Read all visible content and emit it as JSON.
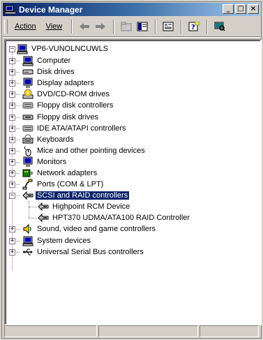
{
  "window": {
    "title": "Device Manager"
  },
  "title_buttons": {
    "minimize": "_",
    "maximize": "□",
    "close": "×"
  },
  "menu": {
    "action": "Action",
    "view": "View"
  },
  "tree": {
    "root": "VP6-VUNOLNCUWLS",
    "categories": [
      {
        "label": "Computer",
        "icon": "computer-icon"
      },
      {
        "label": "Disk drives",
        "icon": "disk-drive-icon"
      },
      {
        "label": "Display adapters",
        "icon": "monitor-icon"
      },
      {
        "label": "DVD/CD-ROM drives",
        "icon": "cdrom-icon"
      },
      {
        "label": "Floppy disk controllers",
        "icon": "controller-icon"
      },
      {
        "label": "Floppy disk drives",
        "icon": "floppy-icon"
      },
      {
        "label": "IDE ATA/ATAPI controllers",
        "icon": "controller-icon"
      },
      {
        "label": "Keyboards",
        "icon": "keyboard-icon"
      },
      {
        "label": "Mice and other pointing devices",
        "icon": "mouse-icon"
      },
      {
        "label": "Monitors",
        "icon": "monitor-icon"
      },
      {
        "label": "Network adapters",
        "icon": "network-icon"
      },
      {
        "label": "Ports (COM & LPT)",
        "icon": "port-icon"
      },
      {
        "label": "SCSI and RAID controllers",
        "icon": "scsi-icon",
        "expanded": true,
        "selected": true,
        "children": [
          {
            "label": "Highpoint RCM Device",
            "icon": "scsi-icon"
          },
          {
            "label": "HPT370 UDMA/ATA100 RAID Controller",
            "icon": "scsi-icon"
          }
        ]
      },
      {
        "label": "Sound, video and game controllers",
        "icon": "speaker-icon"
      },
      {
        "label": "System devices",
        "icon": "computer-icon"
      },
      {
        "label": "Universal Serial Bus controllers",
        "icon": "usb-icon"
      }
    ]
  },
  "expander": {
    "collapsed": "+",
    "expanded": "−"
  }
}
